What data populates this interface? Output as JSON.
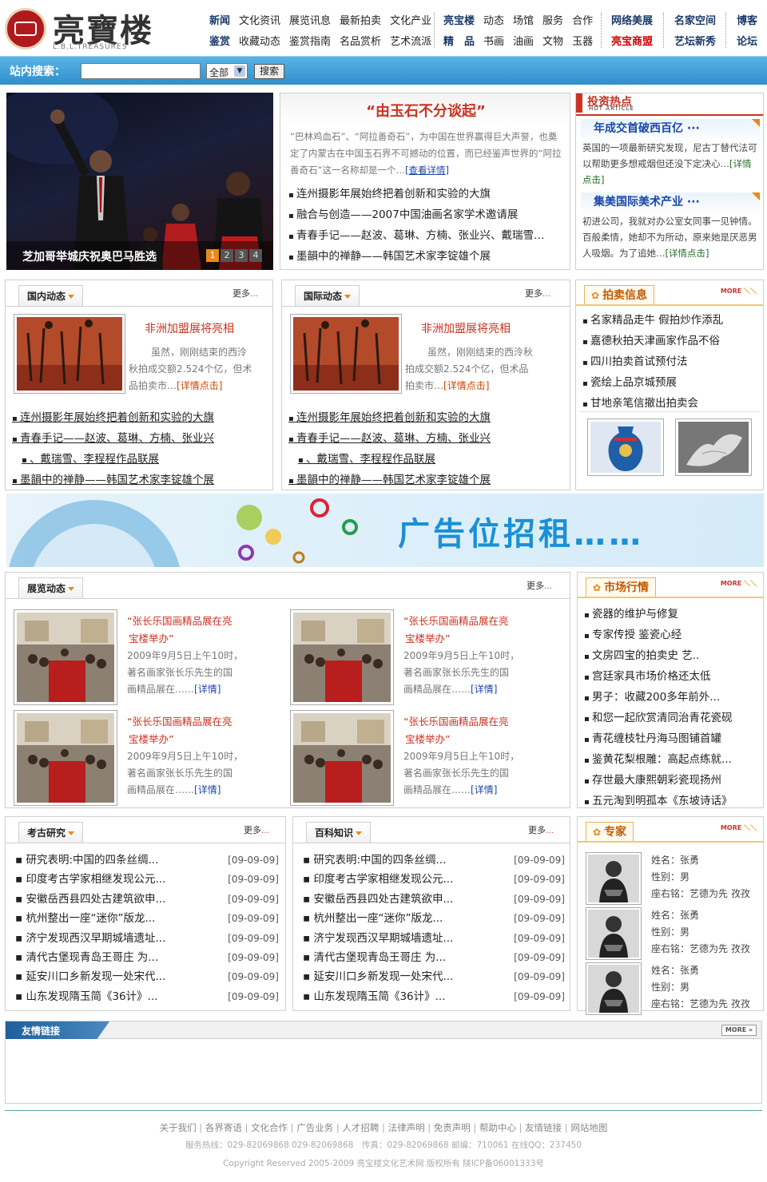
{
  "header": {
    "logo_text": "亮寶楼",
    "logo_sub": "L.B.L.TREASURES",
    "nav_rows": [
      {
        "g1": [
          "新闻",
          "文化资讯",
          "展览讯息",
          "最新拍卖",
          "文化产业"
        ],
        "g2": [
          "亮宝楼",
          "动态",
          "场馆",
          "服务",
          "合作"
        ],
        "g3": "网络美展",
        "g4": "名家空间",
        "g5": "博客"
      },
      {
        "g1": [
          "鉴赏",
          "收藏动态",
          "鉴赏指南",
          "名品赏析",
          "艺术流派"
        ],
        "g2": [
          "精　品",
          "书画",
          "油画",
          "文物",
          "玉器"
        ],
        "g3": "亮宝商盟",
        "g4": "艺坛新秀",
        "g5": "论坛"
      }
    ]
  },
  "search": {
    "label": "站内搜索：",
    "value": "",
    "select": "全部",
    "button": "搜索"
  },
  "hero": {
    "caption": "芝加哥举城庆祝奥巴马胜选",
    "pages": [
      "1",
      "2",
      "3",
      "4"
    ]
  },
  "feature": {
    "title": "“由玉石不分谈起”",
    "summary": "“巴林鸡血石”、“阿拉善奇石”，为中国在世界赢得巨大声誉，也奠定了内蒙古在中国玉石界不可撼动的位置，而已经鉴声世界的“阿拉善奇石”这一名称却是一个…",
    "more": "[查看详情]",
    "items": [
      "连州摄影年展始终把着创新和实验的大旗",
      "融合与创造——2007中国油画名家学术邀请展",
      "青春手记——赵波、葛琳、方楠、张业兴、戴瑞雪…",
      "墨韻中的禅静——韩国艺术家李锭雄个展"
    ]
  },
  "hot": {
    "title": "投资热点",
    "subtitle": "HOT ARTICLE",
    "items": [
      {
        "title": "年成交首破西百亿 ···",
        "body": "英国的一项最新研究发现，尼古丁替代法可以帮助更多想戒烟但还没下定决心…",
        "more": "[详情点击]"
      },
      {
        "title": "集美国际美术产业 ···",
        "body": "初进公司，我就对办公室女同事一见钟情。百般柔情，她却不为所动，原来她是厌恶男人吸烟。为了追她…",
        "more": "[详情点击]"
      }
    ]
  },
  "domestic": {
    "tab": "国内动态",
    "more": "更多",
    "headline": "非洲加盟展将亮相",
    "summary": "虽然，刚刚结束的西泠秋拍成交额2.524个亿，但术品拍卖市…",
    "detail": "[详情点击]",
    "items": [
      "连州摄影年展始终把着创新和实验的大旗",
      "青春手记——赵波、葛琳、方楠、张业兴",
      "、戴瑞雪、李程程作品联展",
      "墨韻中的禅静——韩国艺术家李锭雄个展"
    ]
  },
  "international": {
    "tab": "国际动态",
    "more": "更多",
    "headline": "非洲加盟展将亮相",
    "summary": "虽然，刚刚结束的西泠秋拍成交额2.524个亿，但术品拍卖市…",
    "detail": "[详情点击]",
    "items": [
      "连州摄影年展始终把着创新和实验的大旗",
      "青春手记——赵波、葛琳、方楠、张业兴",
      "、戴瑞雪、李程程作品联展",
      "墨韻中的禅静——韩国艺术家李锭雄个展"
    ]
  },
  "auction": {
    "tab": "拍卖信息",
    "more": "MORE",
    "items": [
      "名家精品走牛 假拍炒作添乱",
      "嘉德秋拍天津画家作品不俗",
      "四川拍卖首试预付法",
      "瓷绘上品京城预展",
      "甘地亲笔信撤出拍卖会"
    ]
  },
  "ad": {
    "text": "广告位招租……"
  },
  "exhibition": {
    "tab": "展览动态",
    "more": "更多",
    "cards": [
      {
        "t1": "“张长乐国画精品展在亮",
        "t2": "宝楼举办”",
        "b1": "2009年9月5日上午10时，",
        "b2": "著名画家张长乐先生的国",
        "b3": "画精品展在……",
        "d": "[详情]"
      },
      {
        "t1": "“张长乐国画精品展在亮",
        "t2": "宝楼举办”",
        "b1": "2009年9月5日上午10时，",
        "b2": "著名画家张长乐先生的国",
        "b3": "画精品展在……",
        "d": "[详情]"
      },
      {
        "t1": "“张长乐国画精品展在亮",
        "t2": "宝楼举办”",
        "b1": "2009年9月5日上午10时，",
        "b2": "著名画家张长乐先生的国",
        "b3": "画精品展在……",
        "d": "[详情]"
      },
      {
        "t1": "“张长乐国画精品展在亮",
        "t2": "宝楼举办”",
        "b1": "2009年9月5日上午10时，",
        "b2": "著名画家张长乐先生的国",
        "b3": "画精品展在……",
        "d": "[详情]"
      }
    ]
  },
  "market": {
    "tab": "市场行情",
    "more": "MORE",
    "items": [
      "瓷器的维护与修复",
      "专家传授 鉴瓷心经",
      "文房四宝的拍卖史 艺..",
      "宫廷家具市场价格还太低",
      "男子：收藏200多年前外...",
      "和您一起欣赏清同治青花瓷砚",
      "青花缠枝牡丹海马图铺首罐",
      "鉴黄花梨根雕：高起点练就...",
      "存世最大康熙朝彩瓷现扬州",
      "五元淘到明孤本《东坡诗话》"
    ]
  },
  "archaeology": {
    "tab": "考古研究",
    "more": "更多",
    "items": [
      {
        "t": "研究表明:中国的四条丝绸...",
        "d": "[09-09-09]"
      },
      {
        "t": "印度考古学家相继发现公元...",
        "d": "[09-09-09]"
      },
      {
        "t": "安徽岳西县四处古建筑欲申...",
        "d": "[09-09-09]"
      },
      {
        "t": "杭州整出一座“迷你”版龙...",
        "d": "[09-09-09]"
      },
      {
        "t": "济宁发现西汉早期城墙遗址...",
        "d": "[09-09-09]"
      },
      {
        "t": "清代古堡现青岛王哥庄 为...",
        "d": "[09-09-09]"
      },
      {
        "t": "延安川口乡新发现一处宋代...",
        "d": "[09-09-09]"
      },
      {
        "t": "山东发现隋玉简《36计》...",
        "d": "[09-09-09]"
      }
    ]
  },
  "encyclopedia": {
    "tab": "百科知识",
    "more": "更多",
    "items": [
      {
        "t": "研究表明:中国的四条丝绸...",
        "d": "[09-09-09]"
      },
      {
        "t": "印度考古学家相继发现公元...",
        "d": "[09-09-09]"
      },
      {
        "t": "安徽岳西县四处古建筑欲申...",
        "d": "[09-09-09]"
      },
      {
        "t": "杭州整出一座“迷你”版龙...",
        "d": "[09-09-09]"
      },
      {
        "t": "济宁发现西汉早期城墙遗址...",
        "d": "[09-09-09]"
      },
      {
        "t": "清代古堡现青岛王哥庄 为...",
        "d": "[09-09-09]"
      },
      {
        "t": "延安川口乡新发现一处宋代...",
        "d": "[09-09-09]"
      },
      {
        "t": "山东发现隋玉简《36计》...",
        "d": "[09-09-09]"
      }
    ]
  },
  "experts": {
    "tab": "专家",
    "more": "MORE",
    "items": [
      {
        "name": "姓名：张勇",
        "gender": "性别：男",
        "motto": "座右铭：艺德为先 孜孜"
      },
      {
        "name": "姓名：张勇",
        "gender": "性别：男",
        "motto": "座右铭：艺德为先 孜孜"
      },
      {
        "name": "姓名：张勇",
        "gender": "性别：男",
        "motto": "座右铭：艺德为先 孜孜"
      }
    ]
  },
  "links": {
    "title": "友情链接",
    "more": "MORE"
  },
  "footer": {
    "links": [
      "关于我们",
      "各界寄语",
      "文化合作",
      "广告业务",
      "人才招聘",
      "法律声明",
      "免责声明",
      "帮助中心",
      "友情链接",
      "网站地图"
    ],
    "contact": "服务热线：029-82069868 029-82069868　传真：029-82069868 邮编：710061 在线QQ：237450",
    "copyright": "Copyright Reserved 2005-2009 亮宝楼文化艺术网 版权所有 陕ICP备06001333号"
  },
  "colors": {
    "accent_blue": "#2f8fcc",
    "accent_red": "#c32",
    "accent_orange": "#e8891c"
  }
}
